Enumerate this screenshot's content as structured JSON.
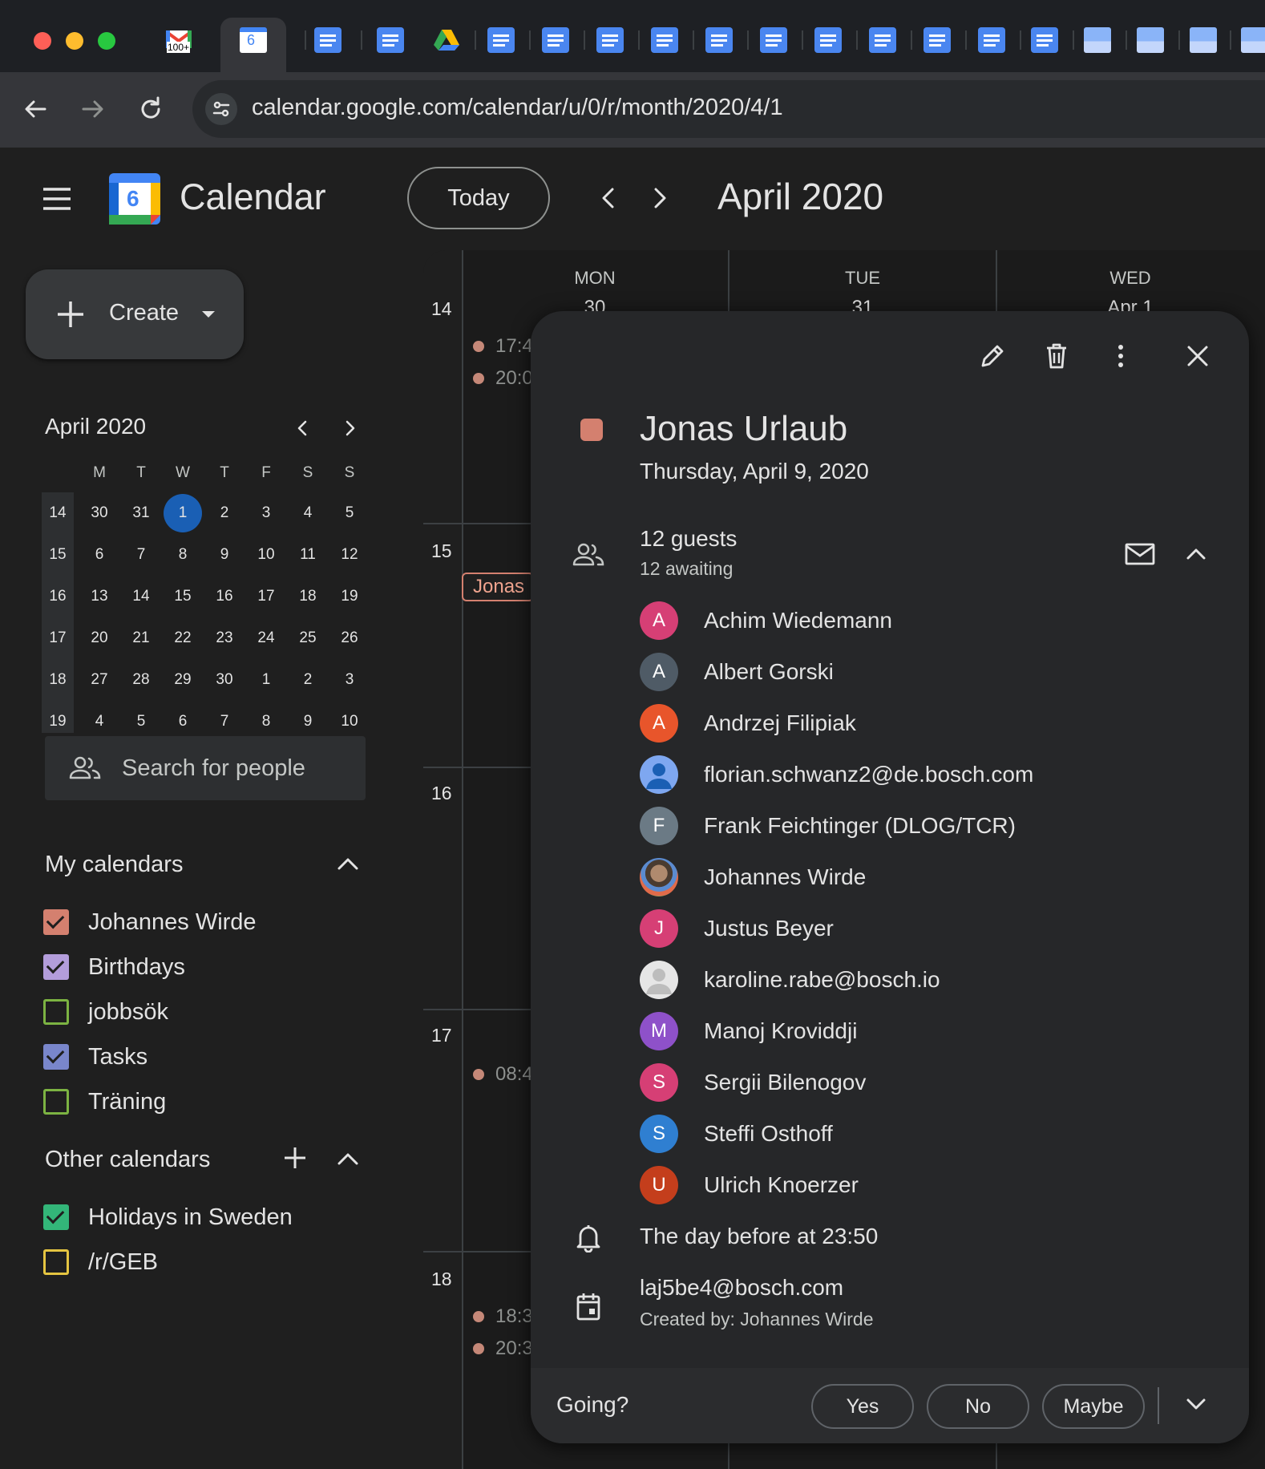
{
  "browser": {
    "url": "calendar.google.com/calendar/u/0/r/month/2020/4/1",
    "gmail_badge": "100+",
    "active_tab_badge": "6"
  },
  "header": {
    "app_name": "Calendar",
    "logo_day": "6",
    "today_label": "Today",
    "month_title": "April 2020"
  },
  "sidebar": {
    "create_label": "Create",
    "mini_calendar": {
      "title": "April 2020",
      "weekdays": [
        "M",
        "T",
        "W",
        "T",
        "F",
        "S",
        "S"
      ],
      "weeks": [
        {
          "num": "14",
          "days": [
            "30",
            "31",
            "1",
            "2",
            "3",
            "4",
            "5"
          ]
        },
        {
          "num": "15",
          "days": [
            "6",
            "7",
            "8",
            "9",
            "10",
            "11",
            "12"
          ]
        },
        {
          "num": "16",
          "days": [
            "13",
            "14",
            "15",
            "16",
            "17",
            "18",
            "19"
          ]
        },
        {
          "num": "17",
          "days": [
            "20",
            "21",
            "22",
            "23",
            "24",
            "25",
            "26"
          ]
        },
        {
          "num": "18",
          "days": [
            "27",
            "28",
            "29",
            "30",
            "1",
            "2",
            "3"
          ]
        },
        {
          "num": "19",
          "days": [
            "4",
            "5",
            "6",
            "7",
            "8",
            "9",
            "10"
          ]
        }
      ]
    },
    "search_people_placeholder": "Search for people",
    "my_calendars_title": "My calendars",
    "my_calendars": [
      {
        "label": "Johannes Wirde",
        "color": "#d4806f",
        "checked": true
      },
      {
        "label": "Birthdays",
        "color": "#b39ddb",
        "checked": true
      },
      {
        "label": "jobbsök",
        "color": "#7cb342",
        "checked": false
      },
      {
        "label": "Tasks",
        "color": "#7986cb",
        "checked": true
      },
      {
        "label": "Träning",
        "color": "#7cb342",
        "checked": false
      }
    ],
    "other_calendars_title": "Other calendars",
    "other_calendars": [
      {
        "label": "Holidays in Sweden",
        "color": "#33b679",
        "checked": true
      },
      {
        "label": "/r/GEB",
        "color": "#e4c441",
        "checked": false
      }
    ]
  },
  "grid": {
    "days": [
      {
        "name": "MON",
        "num": "30"
      },
      {
        "name": "TUE",
        "num": "31"
      },
      {
        "name": "WED",
        "num": "Apr 1"
      }
    ],
    "week_numbers": [
      "14",
      "15",
      "16",
      "17",
      "18"
    ],
    "events": {
      "w14_a": "17:4",
      "w14_b": "20:0",
      "w15_chip": "Jonas",
      "w17_a": "08:4",
      "w18_a": "18:3",
      "w18_b": "20:3"
    }
  },
  "popup": {
    "title": "Jonas Urlaub",
    "color": "#d4806f",
    "date": "Thursday, April 9, 2020",
    "guests_count": "12 guests",
    "guests_awaiting": "12 awaiting",
    "guests": [
      {
        "initial": "A",
        "name": "Achim Wiedemann",
        "color": "#d63f75"
      },
      {
        "initial": "A",
        "name": "Albert Gorski",
        "color": "#4f5b66"
      },
      {
        "initial": "A",
        "name": "Andrzej Filipiak",
        "color": "#e8552b"
      },
      {
        "initial": "",
        "name": "florian.schwanz2@de.bosch.com",
        "color": "#7ea7f0"
      },
      {
        "initial": "F",
        "name": "Frank Feichtinger (DLOG/TCR)",
        "color": "#6b7a85"
      },
      {
        "initial": "",
        "name": "Johannes Wirde",
        "color": "#6b6f74"
      },
      {
        "initial": "J",
        "name": "Justus Beyer",
        "color": "#d63f75"
      },
      {
        "initial": "",
        "name": "karoline.rabe@bosch.io",
        "color": "#e6e6e6"
      },
      {
        "initial": "M",
        "name": "Manoj Kroviddji",
        "color": "#8e51c9"
      },
      {
        "initial": "S",
        "name": "Sergii Bilenogov",
        "color": "#d63f75"
      },
      {
        "initial": "S",
        "name": "Steffi Osthoff",
        "color": "#2f7fd1"
      },
      {
        "initial": "U",
        "name": "Ulrich Knoerzer",
        "color": "#c43e1c"
      }
    ],
    "reminder": "The day before at 23:50",
    "calendar_email": "laj5be4@bosch.com",
    "created_by": "Created by: Johannes Wirde",
    "going_label": "Going?",
    "rsvp": {
      "yes": "Yes",
      "no": "No",
      "maybe": "Maybe"
    }
  }
}
